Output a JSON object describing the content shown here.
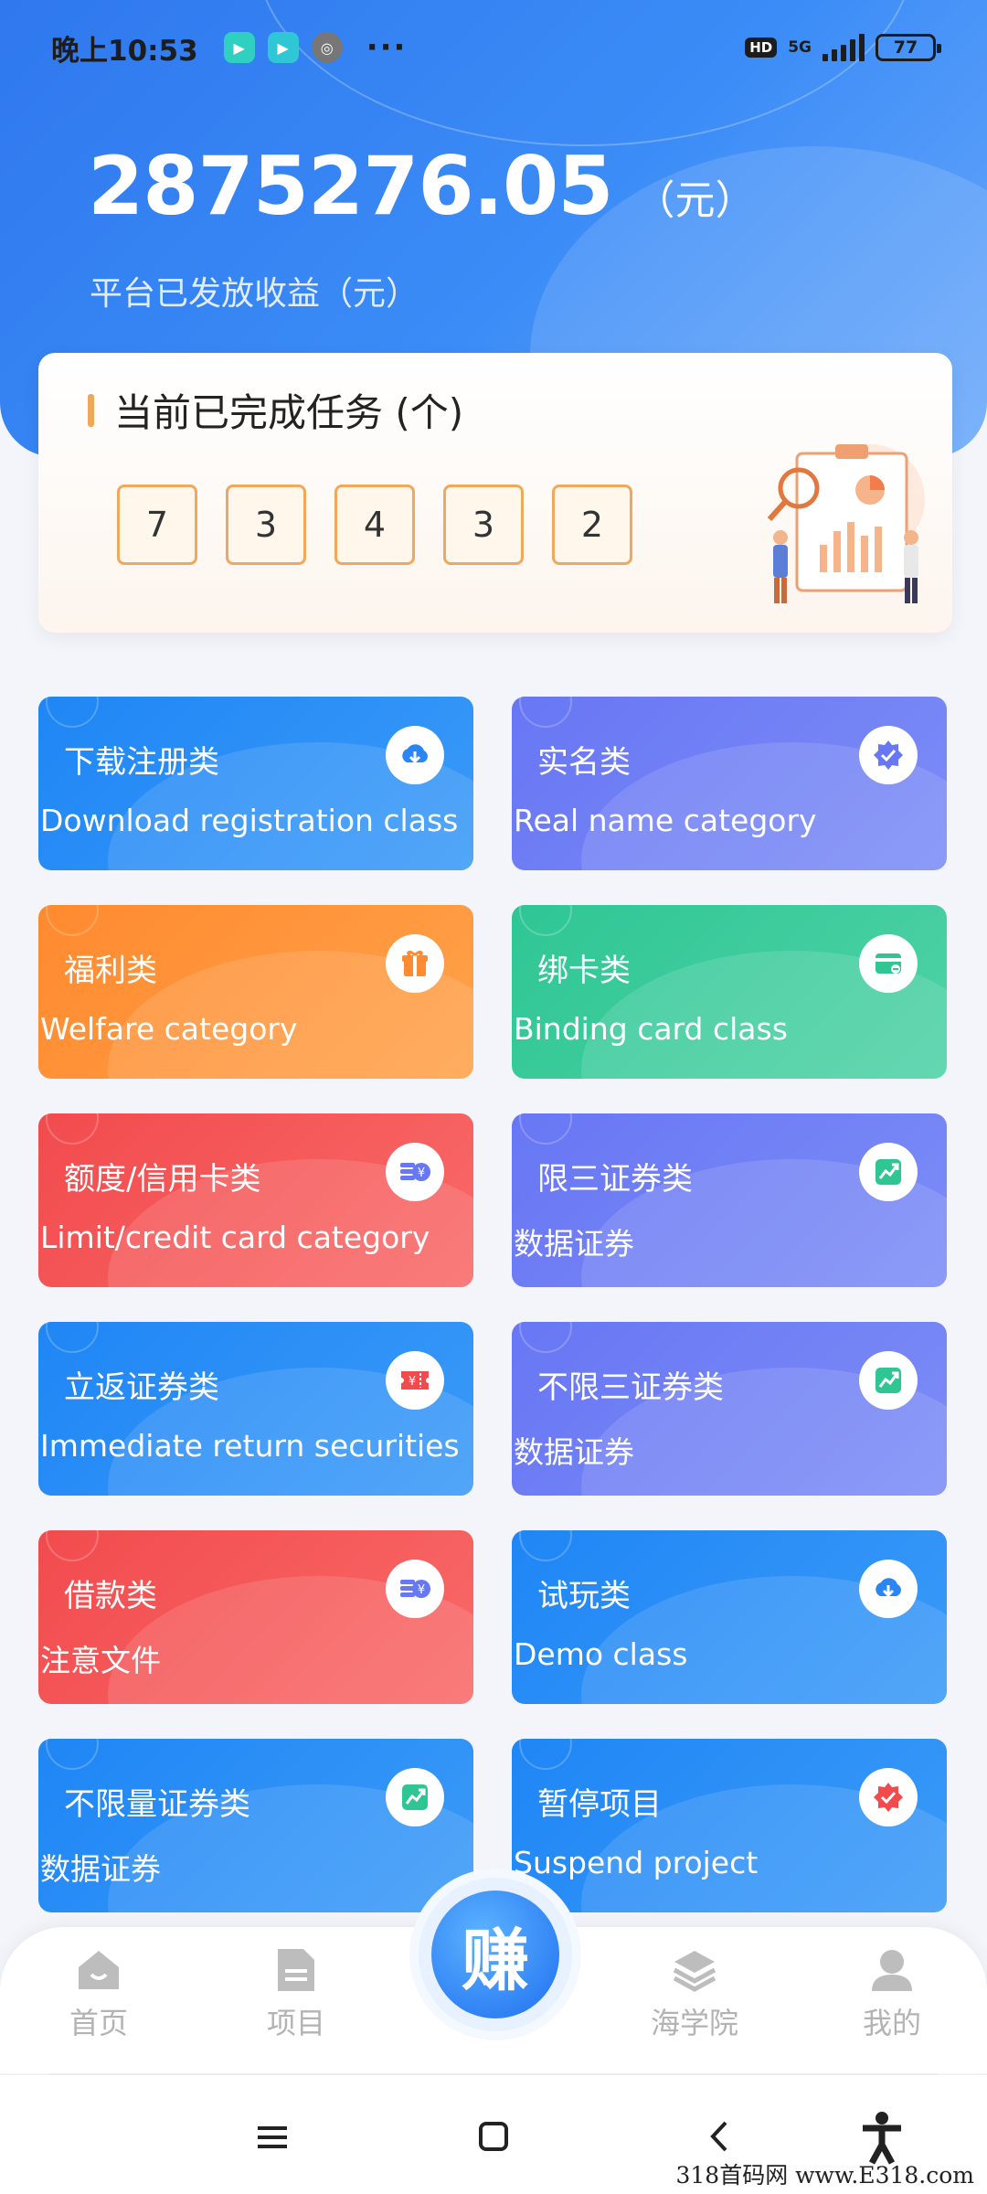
{
  "status_bar": {
    "time": "晚上10:53",
    "more": "···",
    "hd": "HD",
    "network": "5G",
    "battery": "77"
  },
  "header": {
    "amount": "2875276.05",
    "unit": "（元）",
    "subtitle": "平台已发放收益（元）"
  },
  "task_card": {
    "title": "当前已完成任务 (个)",
    "digits": [
      "7",
      "3",
      "4",
      "3",
      "2"
    ]
  },
  "categories": [
    {
      "title": "下载注册类",
      "subtitle": "Download registration class",
      "color": "#1f86f5",
      "icon": "cloud-download-icon"
    },
    {
      "title": "实名类",
      "subtitle": "Real name category",
      "color": "#6877f4",
      "icon": "verified-badge-icon"
    },
    {
      "title": "福利类",
      "subtitle": "Welfare category",
      "color": "#ff8a2f",
      "icon": "gift-icon"
    },
    {
      "title": "绑卡类",
      "subtitle": "Binding card class",
      "color": "#2fc694",
      "icon": "card-icon"
    },
    {
      "title": "额度/信用卡类",
      "subtitle": "Limit/credit card category",
      "color": "#f24b4e",
      "icon": "coins-yen-icon"
    },
    {
      "title": "限三证券类",
      "subtitle": "数据证券",
      "color": "#6877f4",
      "icon": "trend-chart-icon"
    },
    {
      "title": "立返证券类",
      "subtitle": "Immediate return securities",
      "color": "#1f86f5",
      "icon": "yen-ticket-icon"
    },
    {
      "title": "不限三证券类",
      "subtitle": "数据证券",
      "color": "#6877f4",
      "icon": "trend-chart-icon"
    },
    {
      "title": "借款类",
      "subtitle": "注意文件",
      "color": "#f24b4e",
      "icon": "coins-yen-icon"
    },
    {
      "title": "试玩类",
      "subtitle": "Demo class",
      "color": "#1f86f5",
      "icon": "cloud-download-icon"
    },
    {
      "title": "不限量证券类",
      "subtitle": "数据证券",
      "color": "#1f86f5",
      "icon": "trend-chart-icon"
    },
    {
      "title": "暂停项目",
      "subtitle": "Suspend project",
      "color": "#1f86f5",
      "icon": "verified-badge-icon"
    }
  ],
  "bottom_nav": {
    "home": "首页",
    "projects": "项目",
    "earn": "赚",
    "academy": "海学院",
    "mine": "我的"
  },
  "watermark": "318首码网 www.E318.com"
}
